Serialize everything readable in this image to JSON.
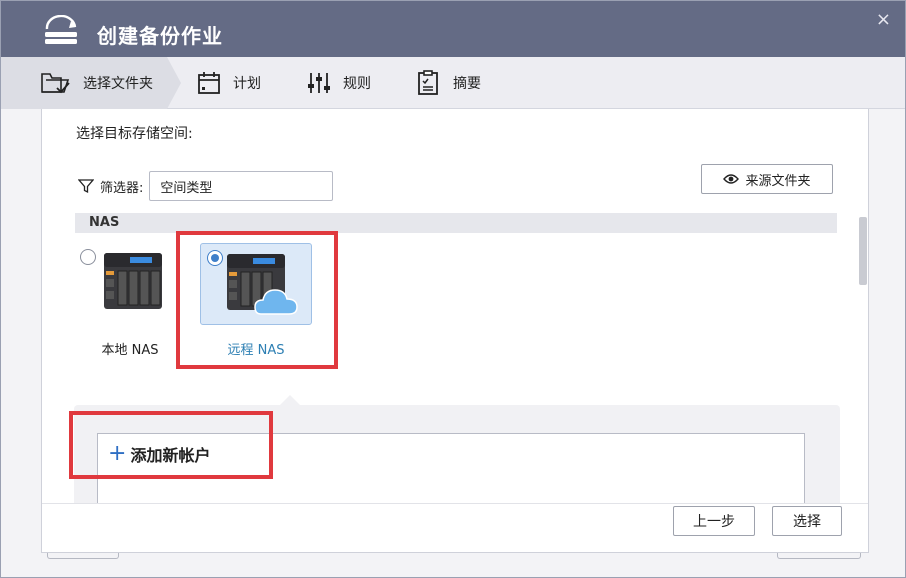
{
  "window": {
    "title": "创建备份作业",
    "close_glyph": "×"
  },
  "steps": [
    {
      "label": "选择文件夹",
      "icon": "folder-check-icon"
    },
    {
      "label": "计划",
      "icon": "calendar-icon"
    },
    {
      "label": "规则",
      "icon": "sliders-icon"
    },
    {
      "label": "摘要",
      "icon": "clipboard-icon"
    }
  ],
  "content": {
    "subtitle": "选择目标存储空间:",
    "filter_label": "筛选器:",
    "filter_value": "空间类型",
    "source_button": "来源文件夹",
    "section": "NAS",
    "nas_items": [
      {
        "label": "本地 NAS",
        "selected": false
      },
      {
        "label": "远程 NAS",
        "selected": true
      }
    ],
    "add_account": "添加新帐户"
  },
  "footer": {
    "prev": "上一步",
    "select": "选择"
  },
  "colors": {
    "titlebar": "#646b85",
    "highlight": "#e0393e",
    "accent": "#3f7fc9",
    "selected_text": "#2d7fb3"
  }
}
